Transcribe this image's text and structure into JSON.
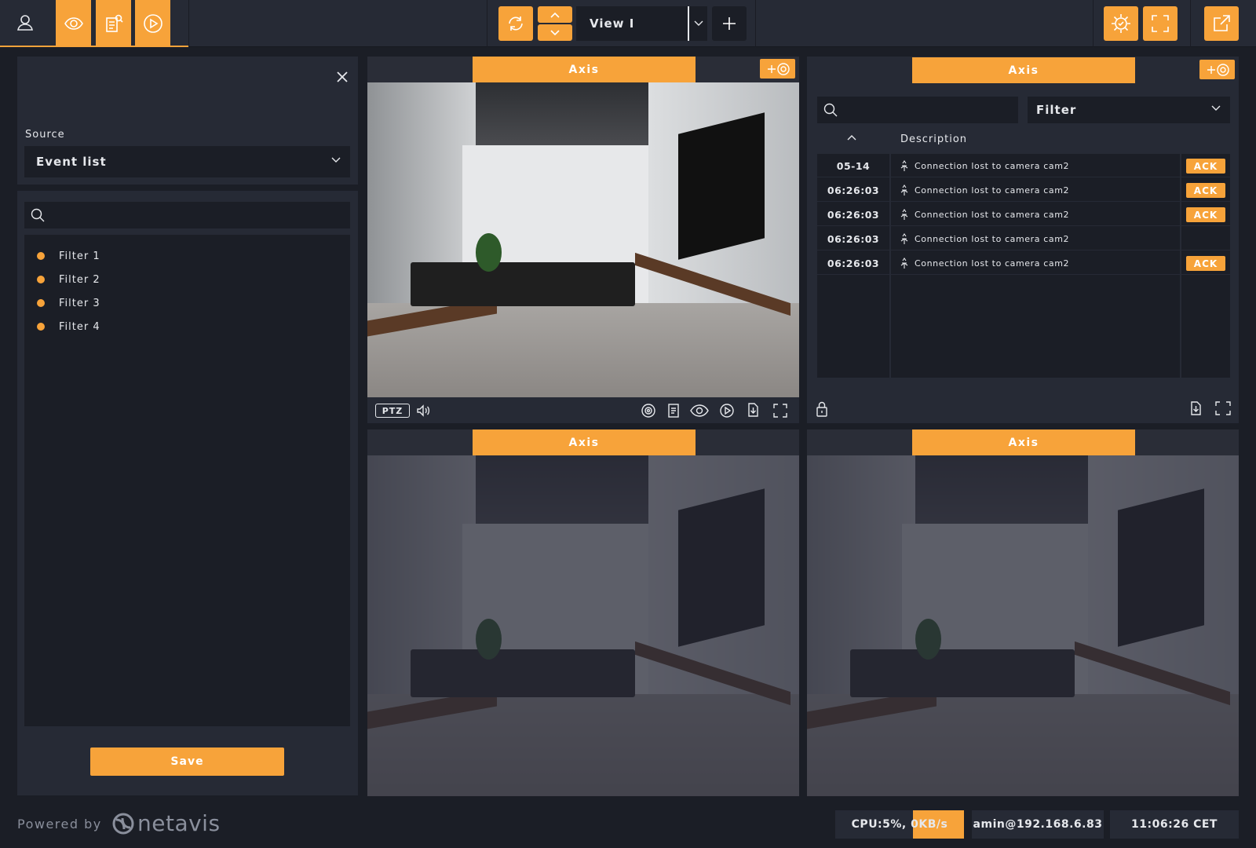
{
  "colors": {
    "accent": "#f7a33a",
    "panel": "#262a35",
    "background": "#1b1e26"
  },
  "topbar": {
    "nav_icons": [
      "user-icon",
      "eye-icon",
      "report-search-icon",
      "play-icon"
    ],
    "view_name": "View I",
    "right_icons": [
      "settings-check-icon",
      "fullscreen-icon",
      "external-link-icon"
    ]
  },
  "left_panel": {
    "source_label": "Source",
    "source_value": "Event list",
    "search_placeholder": "",
    "filters": [
      {
        "label": "Filter 1"
      },
      {
        "label": "Filter 2"
      },
      {
        "label": "Filter 3"
      },
      {
        "label": "Filter 4"
      }
    ],
    "save_label": "Save"
  },
  "tiles": [
    {
      "title": "Axis",
      "ptz_label": "PTZ"
    },
    {
      "title": "Axis"
    },
    {
      "title": "Axis"
    },
    {
      "title": "Axis"
    }
  ],
  "event_panel": {
    "search_placeholder": "",
    "filter_label": "Filter",
    "column_description": "Description",
    "rows": [
      {
        "time": "05-14",
        "description": "Connection lost to camera cam2",
        "ack": "ACK"
      },
      {
        "time": "06:26:03",
        "description": "Connection lost to camera cam2",
        "ack": "ACK"
      },
      {
        "time": "06:26:03",
        "description": "Connection lost to camera cam2",
        "ack": "ACK"
      },
      {
        "time": "06:26:03",
        "description": "Connection lost to camera cam2",
        "ack": ""
      },
      {
        "time": "06:26:03",
        "description": "Connection lost to camera cam2",
        "ack": "ACK"
      }
    ]
  },
  "footer": {
    "powered_by": "Powered by",
    "brand": "netavis",
    "cpu": "CPU:5%, 0KB/s",
    "user": "amin@192.168.6.83",
    "clock": "11:06:26 CET"
  }
}
